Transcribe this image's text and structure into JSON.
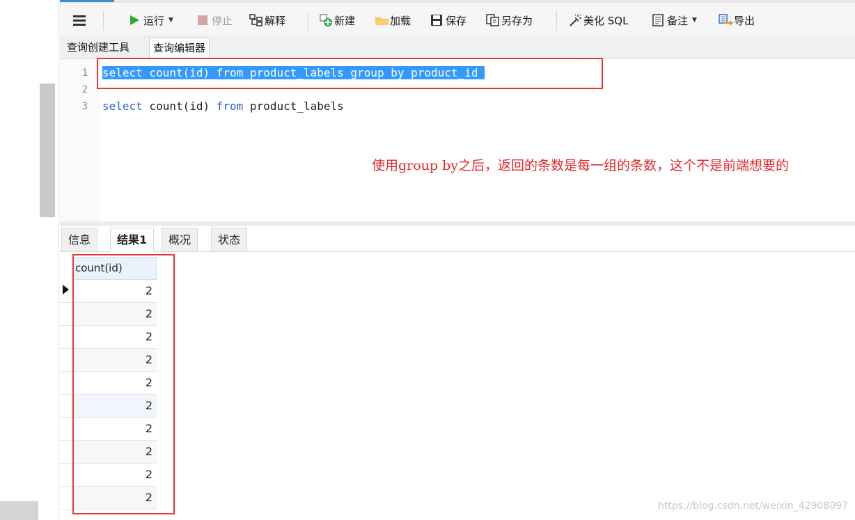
{
  "toolbar": {
    "run_label": "运行",
    "stop_label": "停止",
    "explain_label": "解释",
    "new_label": "新建",
    "load_label": "加载",
    "save_label": "保存",
    "save_as_label": "另存为",
    "beautify_label": "美化 SQL",
    "note_label": "备注",
    "export_label": "导出"
  },
  "editor_tabs": [
    "查询创建工具",
    "查询编辑器"
  ],
  "code": {
    "line_numbers": [
      "1",
      "2",
      "3"
    ],
    "line1": {
      "kw_select": "select",
      "fn": " count(id) ",
      "kw_from": "from",
      "tbl": " product_labels ",
      "kw_group": "group by",
      "rest": " product_id "
    },
    "line3": {
      "kw_select": "select",
      "fn": " count(id) ",
      "kw_from": "from",
      "tbl": " product_labels"
    }
  },
  "annotation": "使用group by之后，返回的条数是每一组的条数，这个不是前端想要的",
  "result_tabs": [
    "信息",
    "结果1",
    "概况",
    "状态"
  ],
  "grid": {
    "column": "count(id)",
    "rows": [
      "2",
      "2",
      "2",
      "2",
      "2",
      "2",
      "2",
      "2",
      "2",
      "2"
    ]
  },
  "watermark": "https://blog.csdn.net/weixin_42908097",
  "colors": {
    "keyword": "#2f5fd0",
    "selection": "#3399ff",
    "annotation": "#e0282c",
    "highlight_box": "#e53935"
  }
}
